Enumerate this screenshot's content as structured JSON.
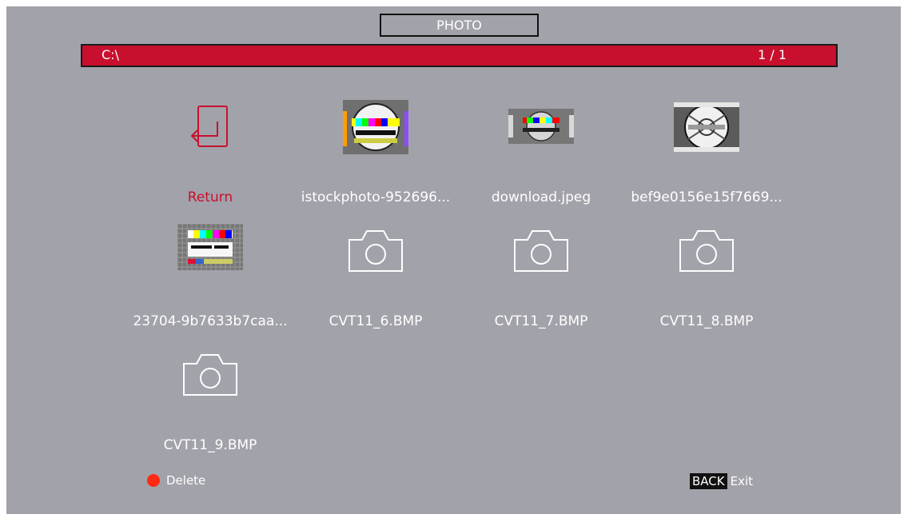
{
  "window": {
    "title": "PHOTO"
  },
  "path_bar": {
    "path": "C:\\",
    "page": "1 / 1"
  },
  "items": [
    {
      "label": "Return",
      "icon": "return-icon"
    },
    {
      "label": "istockphoto-952696...",
      "icon": "test-pattern-thumbnail"
    },
    {
      "label": "download.jpeg",
      "icon": "test-pattern-thumbnail"
    },
    {
      "label": "bef9e0156e15f7669...",
      "icon": "test-pattern-thumbnail"
    },
    {
      "label": "23704-9b7633b7caa...",
      "icon": "test-pattern-thumbnail"
    },
    {
      "label": "CVT11_6.BMP",
      "icon": "camera-icon"
    },
    {
      "label": "CVT11_7.BMP",
      "icon": "camera-icon"
    },
    {
      "label": "CVT11_8.BMP",
      "icon": "camera-icon"
    },
    {
      "label": "CVT11_9.BMP",
      "icon": "camera-icon"
    }
  ],
  "footer": {
    "delete_label": "Delete",
    "back_key": "BACK",
    "exit_label": "Exit"
  },
  "colors": {
    "background": "#a2a2aa",
    "accent_red": "#c8102e",
    "delete_dot": "#ff2a16",
    "text": "#ffffff"
  }
}
